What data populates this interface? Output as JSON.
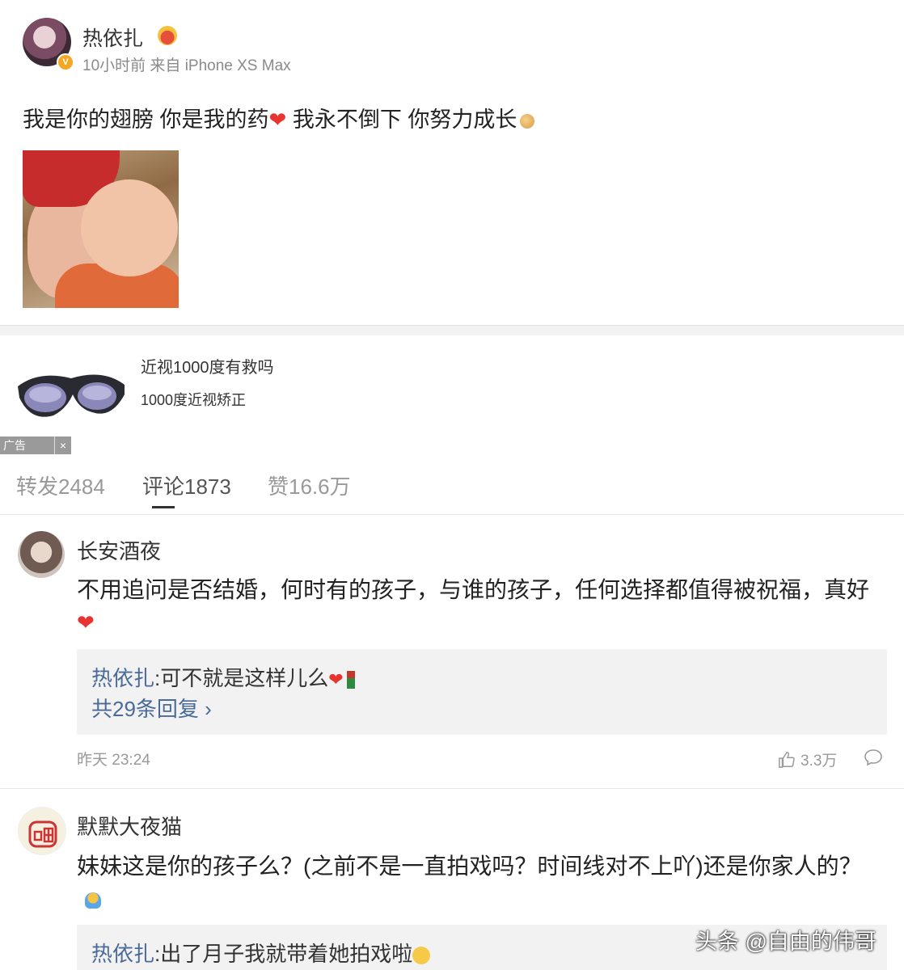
{
  "post": {
    "author": "热依扎",
    "meta": "10小时前 来自 iPhone XS Max",
    "text_part1": "我是你的翅膀 你是我的药",
    "text_part2": " 我永不倒下 你努力成长",
    "heart": "❤"
  },
  "ad": {
    "title": "近视1000度有救吗",
    "subtitle": "1000度近视矫正",
    "badge": "广告",
    "close": "×"
  },
  "tabs": [
    {
      "label": "转发2484"
    },
    {
      "label": "评论1873"
    },
    {
      "label": "赞16.6万"
    }
  ],
  "comments": [
    {
      "name": "长安酒夜",
      "text": "不用追问是否结婚，何时有的孩子，与谁的孩子，任何选择都值得被祝福，真好",
      "reply_author": "热依扎",
      "reply_text": ":可不就是这样儿么",
      "reply_more": "共29条回复",
      "time": "昨天 23:24",
      "likes": "3.3万"
    },
    {
      "name": "默默大夜猫",
      "text": "妹妹这是你的孩子么？(之前不是一直拍戏吗？时间线对不上吖)还是你家人的？",
      "reply_author": "热依扎",
      "reply_text": ":出了月子我就带着她拍戏啦"
    }
  ],
  "watermark": "头条 @自由的伟哥",
  "colors": {
    "link": "#4a6b99",
    "heart": "#e8332f",
    "badge": "#f5a623"
  }
}
